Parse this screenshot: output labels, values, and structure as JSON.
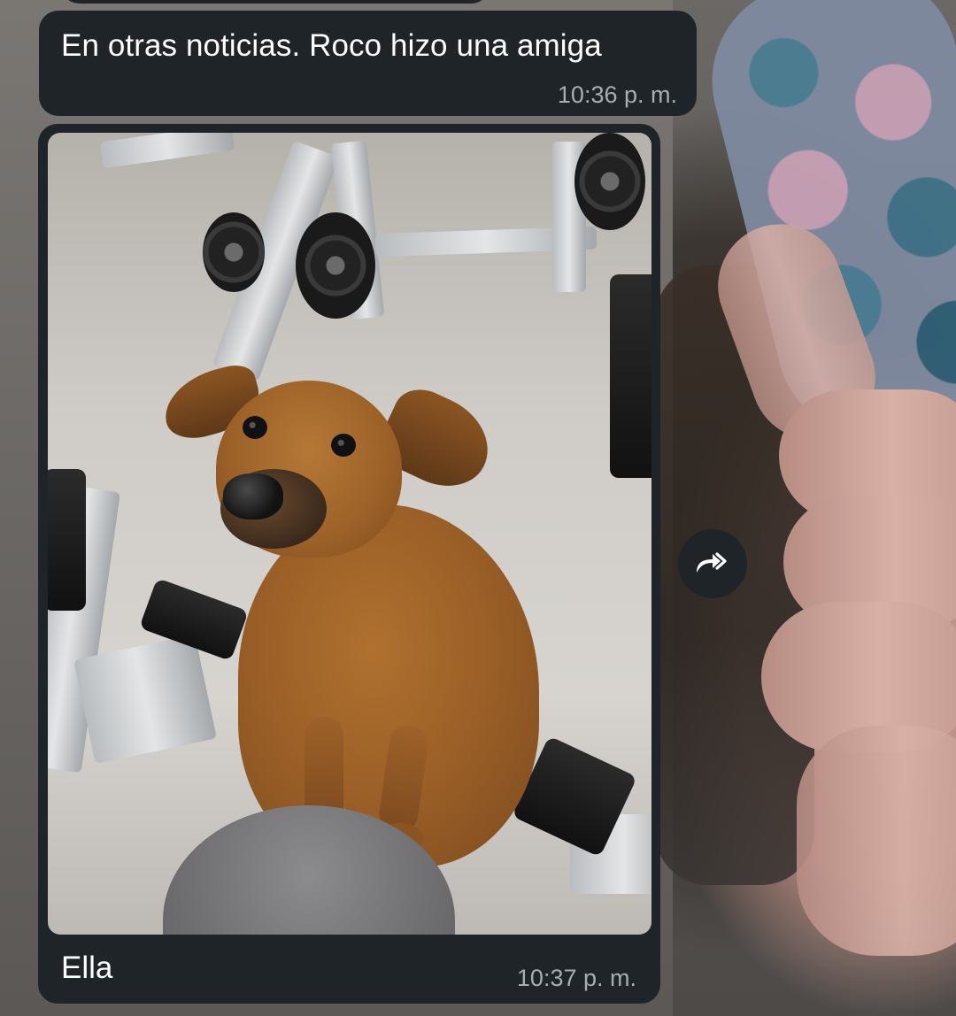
{
  "chat": {
    "messages": [
      {
        "type": "text",
        "text": "En otras noticias. Roco hizo una amiga",
        "time": "10:36 p. m."
      },
      {
        "type": "photo",
        "caption": "Ella",
        "time": "10:37 p. m."
      }
    ]
  },
  "actions": {
    "forward_icon": "double-share-arrow-icon"
  },
  "colors": {
    "bubble_bg": "#1f2429",
    "text_primary": "#ffffff",
    "text_time": "#a7adb3"
  }
}
